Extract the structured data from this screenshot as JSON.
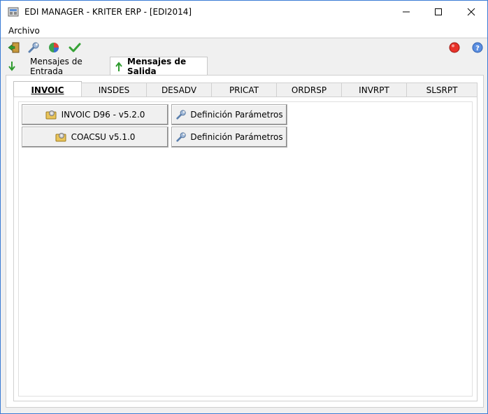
{
  "window": {
    "title": "EDI MANAGER - KRITER ERP - [EDI2014]"
  },
  "menu": {
    "archivo": "Archivo"
  },
  "toolbar": {
    "icons": [
      "exit-icon",
      "wrench-icon",
      "pie-chart-icon",
      "checkmark-icon",
      "red-record-icon",
      "help-icon"
    ]
  },
  "outer_tabs": [
    {
      "label": "Mensajes de Entrada",
      "active": false
    },
    {
      "label": "Mensajes de Salida",
      "active": true
    }
  ],
  "inner_tabs": [
    {
      "label": "INVOIC",
      "active": true
    },
    {
      "label": "INSDES",
      "active": false
    },
    {
      "label": "DESADV",
      "active": false
    },
    {
      "label": "PRICAT",
      "active": false
    },
    {
      "label": "ORDRSP",
      "active": false
    },
    {
      "label": "INVRPT",
      "active": false
    },
    {
      "label": "SLSRPT",
      "active": false
    }
  ],
  "buttons": {
    "invoic_d96": "INVOIC D96 - v5.2.0",
    "param_1": "Definición Parámetros",
    "coacsu": "COACSU v5.1.0",
    "param_2": "Definición Parámetros"
  },
  "colors": {
    "accent_border": "#3a7bd5",
    "green_arrow": "#2e9b2e",
    "record_red": "#e8322a"
  }
}
